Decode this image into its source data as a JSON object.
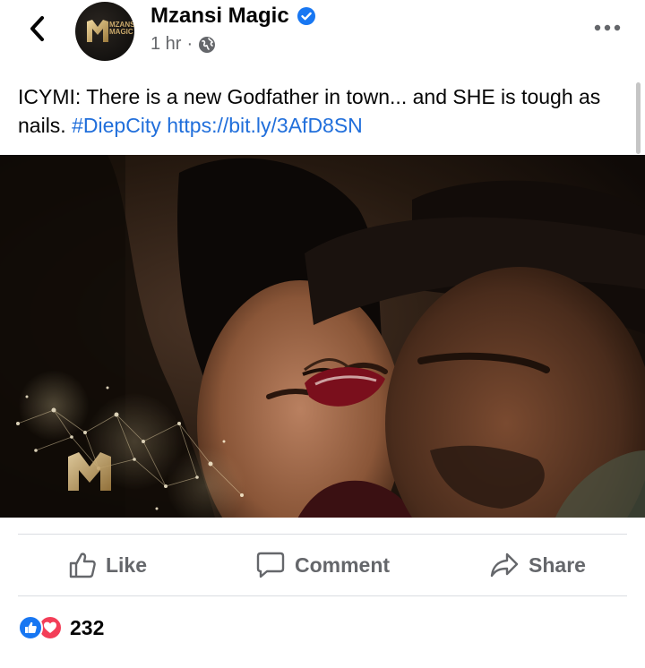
{
  "page": {
    "name": "Mzansi Magic",
    "time": "1 hr",
    "separator": "·",
    "avatar_logo_text": [
      "MZANSI",
      "MAGIC"
    ]
  },
  "post": {
    "text": "ICYMI: There is a new Godfather in town... and SHE is tough as nails.",
    "hashtag": "#DiepCity",
    "link": "https://bit.ly/3AfD8SN"
  },
  "actions": {
    "like": "Like",
    "comment": "Comment",
    "share": "Share"
  },
  "reactions": {
    "count": "232"
  },
  "icons": {
    "back": "chevron-left-icon",
    "verified": "verified-badge-icon",
    "audience": "globe-icon",
    "more": "more-horizontal-icon",
    "like": "thumbs-up-icon",
    "comment": "comment-bubble-icon",
    "share": "share-arrow-icon"
  },
  "colors": {
    "link": "#216fdb",
    "secondary_text": "#65676b",
    "verified": "#1877f2",
    "like_reaction": "#1877f2",
    "love_reaction": "#f33e58"
  }
}
